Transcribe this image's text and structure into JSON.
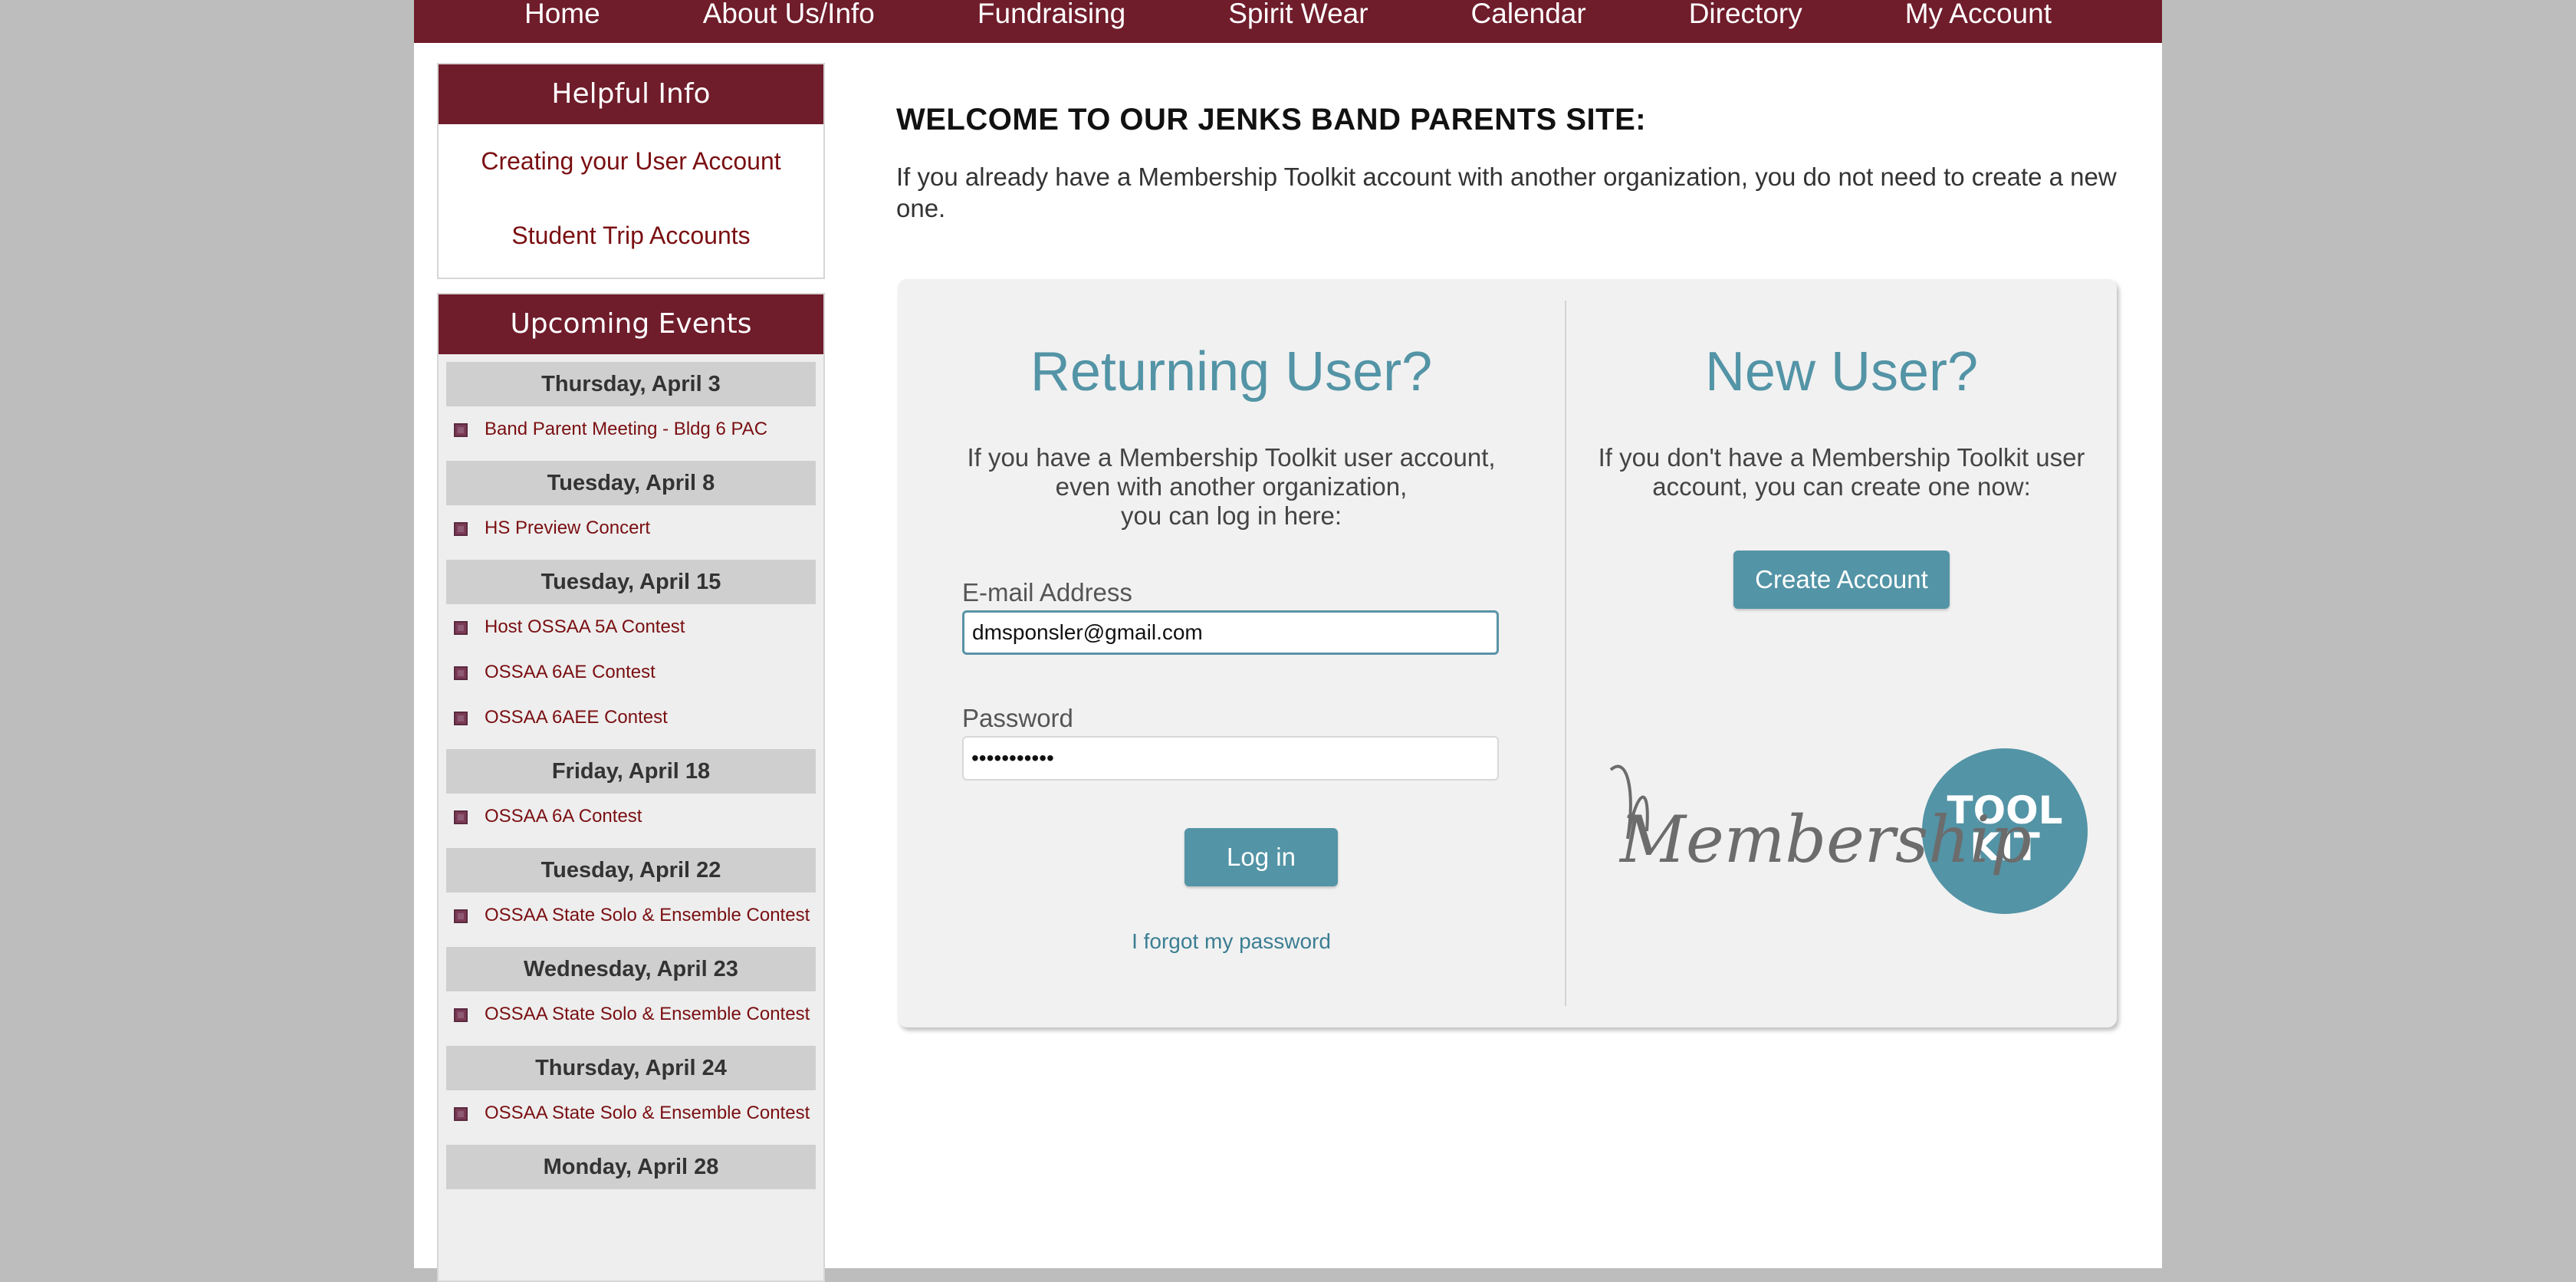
{
  "nav": {
    "items": [
      "Home",
      "About Us/Info",
      "Fundraising",
      "Spirit Wear",
      "Calendar",
      "Directory",
      "My Account"
    ]
  },
  "sidebar": {
    "helpful_title": "Helpful Info",
    "helpful_links": [
      "Creating your User Account",
      "Student Trip Accounts"
    ],
    "events_title": "Upcoming Events",
    "event_days": [
      {
        "date": "Thursday, April 3",
        "events": [
          "Band Parent Meeting - Bldg 6 PAC"
        ]
      },
      {
        "date": "Tuesday, April 8",
        "events": [
          "HS Preview Concert"
        ]
      },
      {
        "date": "Tuesday, April 15",
        "events": [
          "Host OSSAA 5A Contest",
          "OSSAA 6AE Contest",
          "OSSAA 6AEE Contest"
        ]
      },
      {
        "date": "Friday, April 18",
        "events": [
          "OSSAA 6A Contest"
        ]
      },
      {
        "date": "Tuesday, April 22",
        "events": [
          "OSSAA State Solo & Ensemble Contest"
        ]
      },
      {
        "date": "Wednesday, April 23",
        "events": [
          "OSSAA State Solo & Ensemble Contest"
        ]
      },
      {
        "date": "Thursday, April 24",
        "events": [
          "OSSAA State Solo & Ensemble Contest"
        ]
      },
      {
        "date": "Monday, April 28",
        "events": []
      }
    ]
  },
  "main": {
    "welcome_title": "WELCOME TO OUR JENKS BAND PARENTS SITE:",
    "welcome_text": "If you already have a Membership Toolkit account with another organization, you do not need to create a new one.",
    "returning": {
      "heading": "Returning User?",
      "description": "If you have a Membership Toolkit user account,\neven with another organization,\nyou can log in here:",
      "email_label": "E-mail Address",
      "email_value": "dmsponsler@gmail.com",
      "password_label": "Password",
      "password_value": "•••••••••••",
      "login_button": "Log in",
      "forgot_link": "I forgot my password"
    },
    "new_user": {
      "heading": "New User?",
      "description": "If you don't have a Membership Toolkit user\naccount, you can create one now:",
      "create_button": "Create Account",
      "logo_script": "Membership",
      "logo_badge_line1": "TOOL",
      "logo_badge_line2": "KIT"
    }
  },
  "colors": {
    "brand_maroon": "#6f1c2b",
    "link_red": "#7a0f12",
    "accent_teal": "#5394a6"
  }
}
